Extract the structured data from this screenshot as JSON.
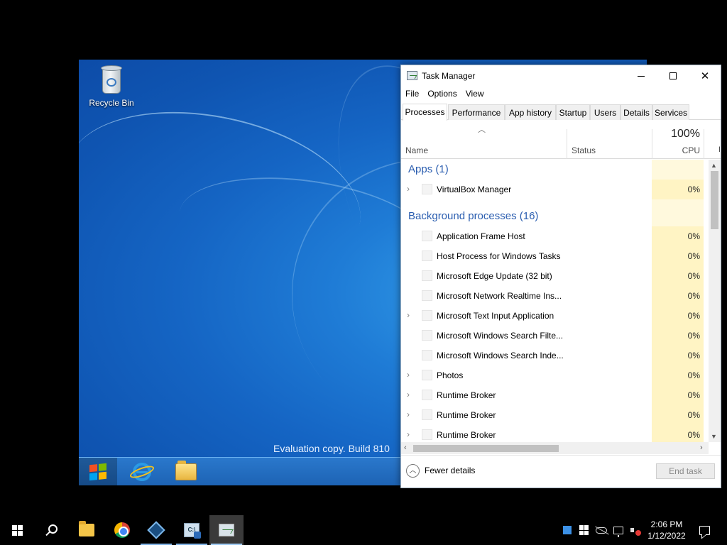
{
  "vm": {
    "recycle_bin_label": "Recycle Bin",
    "watermark": "Evaluation copy. Build 810",
    "taskbar_items": [
      "start",
      "internet-explorer",
      "file-explorer"
    ]
  },
  "task_manager": {
    "title": "Task Manager",
    "menu": [
      "File",
      "Options",
      "View"
    ],
    "tabs": [
      "Processes",
      "Performance",
      "App history",
      "Startup",
      "Users",
      "Details",
      "Services"
    ],
    "active_tab": "Processes",
    "columns": {
      "name": "Name",
      "status": "Status",
      "cpu_percent": "100%",
      "cpu": "CPU",
      "more": "I"
    },
    "groups": {
      "apps": "Apps (1)",
      "background": "Background processes (16)"
    },
    "apps": [
      {
        "name": "VirtualBox Manager",
        "cpu": "0%",
        "expandable": true
      }
    ],
    "background": [
      {
        "name": "Application Frame Host",
        "cpu": "0%",
        "expandable": false
      },
      {
        "name": "Host Process for Windows Tasks",
        "cpu": "0%",
        "expandable": false
      },
      {
        "name": "Microsoft Edge Update (32 bit)",
        "cpu": "0%",
        "expandable": false
      },
      {
        "name": "Microsoft Network Realtime Ins...",
        "cpu": "0%",
        "expandable": false
      },
      {
        "name": "Microsoft Text Input Application",
        "cpu": "0%",
        "expandable": true
      },
      {
        "name": "Microsoft Windows Search Filte...",
        "cpu": "0%",
        "expandable": false
      },
      {
        "name": "Microsoft Windows Search Inde...",
        "cpu": "0%",
        "expandable": false
      },
      {
        "name": "Photos",
        "cpu": "0%",
        "expandable": true
      },
      {
        "name": "Runtime Broker",
        "cpu": "0%",
        "expandable": true
      },
      {
        "name": "Runtime Broker",
        "cpu": "0%",
        "expandable": true
      },
      {
        "name": "Runtime Broker",
        "cpu": "0%",
        "expandable": true
      }
    ],
    "fewer_details": "Fewer details",
    "end_task": "End task"
  },
  "host_taskbar": {
    "clock_time": "2:06 PM",
    "clock_date": "1/12/2022",
    "pinned": [
      "start",
      "search",
      "file-explorer",
      "chrome",
      "virtualbox",
      "command-prompt",
      "task-manager"
    ]
  },
  "colors": {
    "group_heading": "#2b5eb0",
    "cpu_heat": "#fff4c4",
    "desktop_blue": "#1f7cd6"
  }
}
